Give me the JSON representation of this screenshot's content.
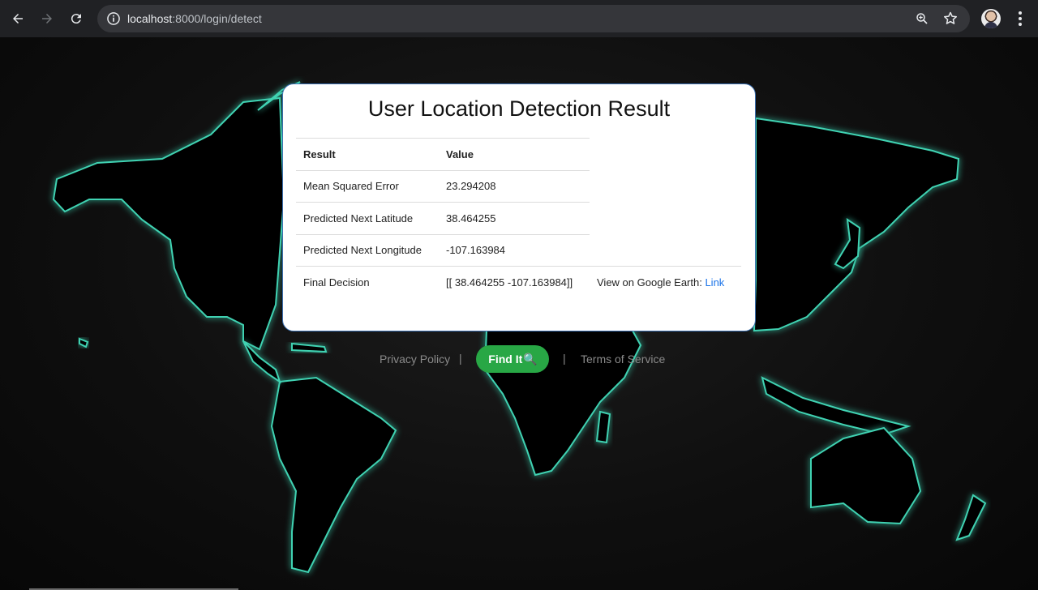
{
  "browser": {
    "url_host": "localhost",
    "url_rest": ":8000/login/detect",
    "icons": [
      "back-icon",
      "forward-icon",
      "reload-icon",
      "info-icon",
      "zoom-icon",
      "star-icon",
      "profile-avatar",
      "menu-icon"
    ]
  },
  "card": {
    "title": "User Location Detection Result",
    "header": {
      "col1": "Result",
      "col2": "Value"
    },
    "rows": [
      {
        "label": "Mean Squared Error",
        "value": "23.294208"
      },
      {
        "label": "Predicted Next Latitude",
        "value": "38.464255"
      },
      {
        "label": "Predicted Next Longitude",
        "value": "-107.163984"
      }
    ],
    "final": {
      "label": "Final Decision",
      "value": "[[ 38.464255 -107.163984]]",
      "earth_text": "View on Google Earth: ",
      "link_text": "Link"
    }
  },
  "footer": {
    "privacy": "Privacy Policy",
    "separator": "|",
    "find_button": "Find It",
    "find_icon": "🔍",
    "terms": "Terms of Service"
  },
  "colors": {
    "accent_green": "#28a745",
    "link_blue": "#1a73e8",
    "map_glow": "#3fd2b2"
  }
}
